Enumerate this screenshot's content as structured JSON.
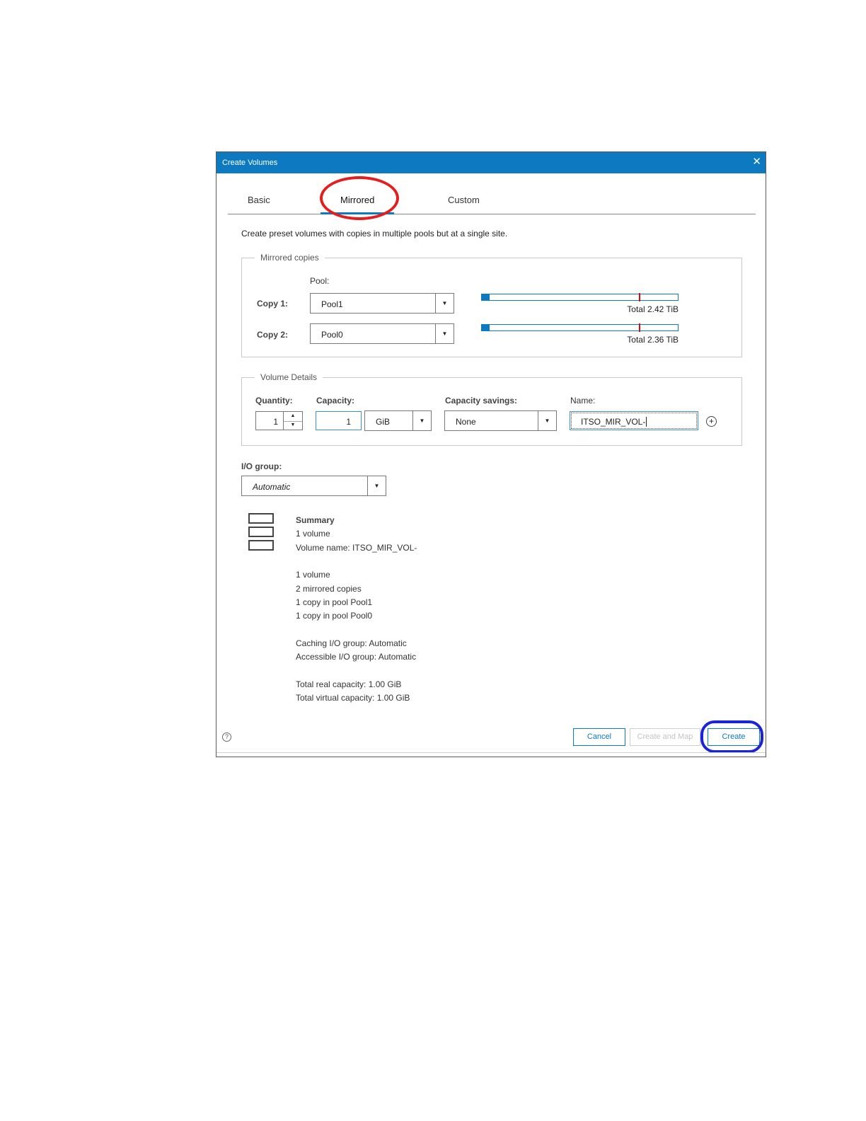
{
  "dialog": {
    "title": "Create Volumes",
    "close_glyph": "✕"
  },
  "tabs": [
    {
      "label": "Basic"
    },
    {
      "label": "Mirrored",
      "active": true
    },
    {
      "label": "Custom"
    }
  ],
  "description": "Create preset volumes with copies in multiple pools but at a single site.",
  "mirrored_copies": {
    "legend": "Mirrored copies",
    "pool_header": "Pool:",
    "copies": [
      {
        "label": "Copy 1:",
        "pool": "Pool1",
        "total": "Total 2.42 TiB",
        "used_fraction": 0.04,
        "threshold_fraction": 0.8
      },
      {
        "label": "Copy 2:",
        "pool": "Pool0",
        "total": "Total 2.36 TiB",
        "used_fraction": 0.04,
        "threshold_fraction": 0.8
      }
    ]
  },
  "volume_details": {
    "legend": "Volume Details",
    "quantity_label": "Quantity:",
    "quantity_value": "1",
    "capacity_label": "Capacity:",
    "capacity_value": "1",
    "capacity_unit": "GiB",
    "savings_label": "Capacity savings:",
    "savings_value": "None",
    "name_label": "Name:",
    "name_value": "ITSO_MIR_VOL-"
  },
  "io_group": {
    "label": "I/O group:",
    "value": "Automatic"
  },
  "summary": {
    "title": "Summary",
    "lines_1": [
      "1 volume",
      "Volume name: ITSO_MIR_VOL-"
    ],
    "lines_2": [
      "1 volume",
      "2 mirrored copies",
      "1 copy in pool Pool1",
      "1 copy in pool Pool0"
    ],
    "lines_3": [
      "Caching I/O group: Automatic",
      "Accessible I/O group: Automatic"
    ],
    "lines_4": [
      "Total real capacity: 1.00 GiB",
      "Total virtual capacity: 1.00 GiB"
    ]
  },
  "footer": {
    "help_glyph": "?",
    "cancel": "Cancel",
    "create_and_map": "Create and Map",
    "create": "Create"
  },
  "colors": {
    "accent": "#0c79c0",
    "highlight_red": "#e41d1d",
    "highlight_blue": "#1a24d8",
    "threshold": "#d40d0d"
  }
}
